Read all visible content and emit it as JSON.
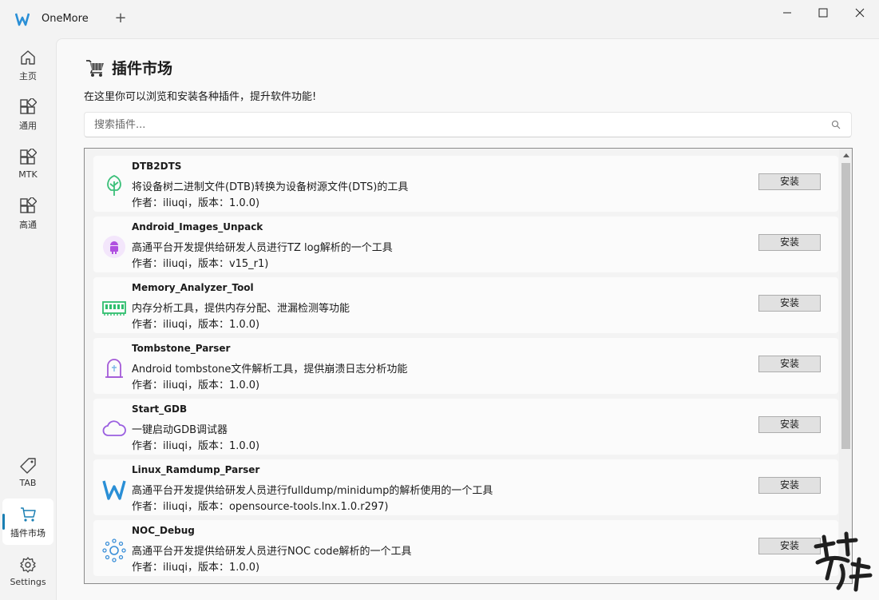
{
  "app": {
    "title": "OneMore",
    "new_tab": "+"
  },
  "sidebar": {
    "items": [
      {
        "label": "主页",
        "icon": "home-icon",
        "active": false
      },
      {
        "label": "通用",
        "icon": "apps-icon",
        "active": false
      },
      {
        "label": "MTK",
        "icon": "apps-icon",
        "active": false
      },
      {
        "label": "高通",
        "icon": "apps-icon",
        "active": false
      },
      {
        "label": "TAB",
        "icon": "tag-icon",
        "active": false
      },
      {
        "label": "插件市场",
        "icon": "cart-icon",
        "active": true
      },
      {
        "label": "Settings",
        "icon": "gear-icon",
        "active": false
      }
    ]
  },
  "page": {
    "title": "插件市场",
    "description": "在这里你可以浏览和安装各种插件，提升软件功能!",
    "search_placeholder": "搜索插件..."
  },
  "plugins": [
    {
      "name": "DTB2DTS",
      "description": "将设备树二进制文件(DTB)转换为设备树源文件(DTS)的工具",
      "meta": "作者：iliuqi，版本：1.0.0)",
      "icon": "tree-icon",
      "install_label": "安装"
    },
    {
      "name": "Android_Images_Unpack",
      "description": "高通平台开发提供给研发人员进行TZ log解析的一个工具",
      "meta": "作者：iliuqi，版本：v15_r1)",
      "icon": "android-icon",
      "install_label": "安装"
    },
    {
      "name": "Memory_Analyzer_Tool",
      "description": "内存分析工具，提供内存分配、泄漏检测等功能",
      "meta": "作者：iliuqi，版本：1.0.0)",
      "icon": "memory-icon",
      "install_label": "安装"
    },
    {
      "name": "Tombstone_Parser",
      "description": "Android tombstone文件解析工具，提供崩溃日志分析功能",
      "meta": "作者：iliuqi，版本：1.0.0)",
      "icon": "tombstone-icon",
      "install_label": "安装"
    },
    {
      "name": "Start_GDB",
      "description": "一键启动GDB调试器",
      "meta": "作者：iliuqi，版本：1.0.0)",
      "icon": "cloud-icon",
      "install_label": "安装"
    },
    {
      "name": "Linux_Ramdump_Parser",
      "description": "高通平台开发提供给研发人员进行fulldump/minidump的解析使用的一个工具",
      "meta": "作者：iliuqi，版本：opensource-tools.lnx.1.0.r297)",
      "icon": "w-logo-icon",
      "install_label": "安装"
    },
    {
      "name": "NOC_Debug",
      "description": "高通平台开发提供给研发人员进行NOC code解析的一个工具",
      "meta": "作者：iliuqi，版本：1.0.0)",
      "icon": "network-icon",
      "install_label": "安装"
    }
  ],
  "colors": {
    "accent": "#1a7fb3",
    "background": "#f3f3f3",
    "card": "#fbfbfb"
  }
}
